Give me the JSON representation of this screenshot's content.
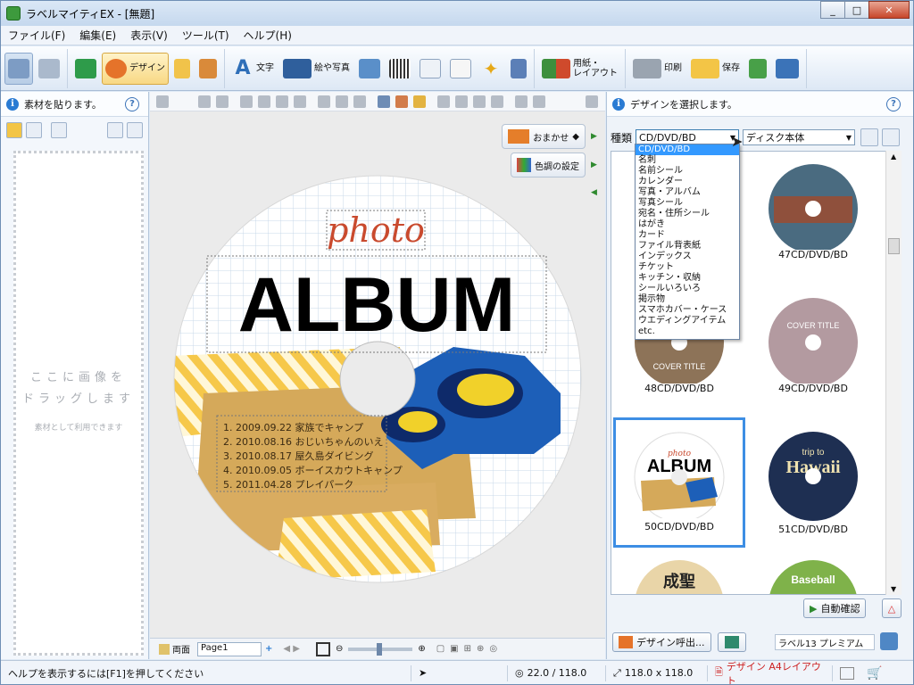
{
  "window": {
    "title": "ラベルマイティEX - [無題]"
  },
  "menu": [
    "ファイル(F)",
    "編集(E)",
    "表示(V)",
    "ツール(T)",
    "ヘルプ(H)"
  ],
  "toolbar": {
    "design_label": "デザイン",
    "text_label": "文字",
    "picture_label": "絵や写真",
    "paper_layout_label": "用紙・\nレイアウト",
    "print_label": "印刷",
    "save_label": "保存"
  },
  "left_panel": {
    "info": "素材を貼ります。",
    "drop_main": "ここに画像を\nドラッグします",
    "drop_sub": "素材として利用できます"
  },
  "canvas": {
    "auto_button": "おまかせ",
    "tone_button": "色調の設定",
    "design": {
      "script_title": "photo",
      "main_title": "ALBUM",
      "entries": [
        "1.  2009.09.22  家族でキャンプ",
        "2.  2010.08.16  おじいちゃんのいえ",
        "3.  2010.08.17  屋久島ダイビング",
        "4.  2010.09.05  ボーイスカウトキャンプ",
        "5.  2011.04.28  プレイパーク"
      ]
    },
    "bottom": {
      "both_sides": "両面",
      "page": "Page1"
    }
  },
  "right_panel": {
    "info": "デザインを選択します。",
    "type_label": "種類",
    "type_value": "CD/DVD/BD",
    "subtype_value": "ディスク本体",
    "type_options": [
      "CD/DVD/BD",
      "名刺",
      "名前シール",
      "カレンダー",
      "写真・アルバム",
      "写真シール",
      "宛名・住所シール",
      "はがき",
      "カード",
      "ファイル背表紙",
      "インデックス",
      "チケット",
      "キッチン・収納",
      "シールいろいろ",
      "掲示物",
      "スマホカバー・ケース",
      "ウエディングアイテム",
      "etc."
    ],
    "thumbs": [
      {
        "label": "",
        "color": "#d4a06a"
      },
      {
        "label": "47CD/DVD/BD",
        "color": "#4a6b80"
      },
      {
        "label": "48CD/DVD/BD",
        "color": "#8d7358"
      },
      {
        "label": "49CD/DVD/BD",
        "color": "#b39aa0"
      },
      {
        "label": "50CD/DVD/BD",
        "color": "#ffffff"
      },
      {
        "label": "51CD/DVD/BD",
        "color": "#1e2f52"
      },
      {
        "label": "",
        "color": "#e9d5a8"
      },
      {
        "label": "",
        "color": "#7fb24a"
      }
    ],
    "thumb_texts": {
      "cover_title": "COVER TITLE",
      "album_mini": "ALBUM",
      "photo_mini": "photo",
      "trip": "trip to",
      "hawaii": "Hawaii",
      "seiya": "成聖",
      "baseball": "Baseball"
    },
    "auto_check": "自動確認",
    "design_call": "デザイン呼出...",
    "label_name": "ラベル13 プレミアム"
  },
  "status": {
    "help": "ヘルプを表示するには[F1]を押してください",
    "coords": "22.0 / 118.0",
    "size": "118.0 x 118.0",
    "layout": "デザイン A4レイアウト"
  }
}
